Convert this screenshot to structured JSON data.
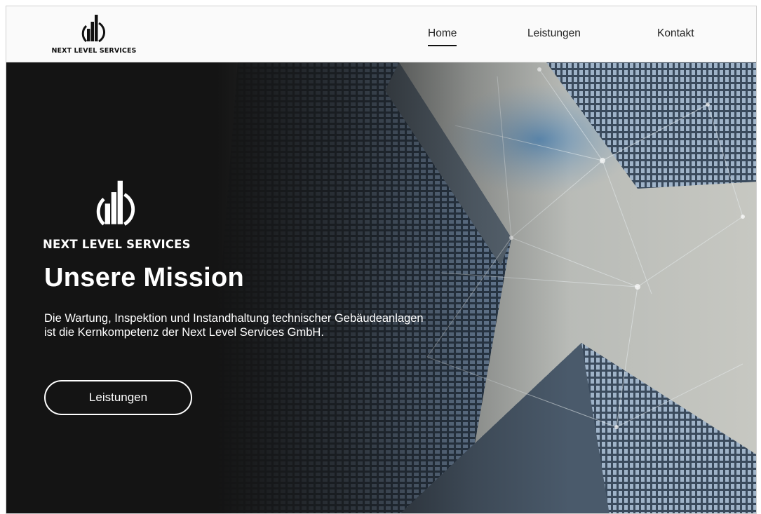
{
  "brand": {
    "name": "NEXT LEVEL SERVICES",
    "logo_icon": "building-bars-logo"
  },
  "nav": {
    "items": [
      {
        "label": "Home",
        "active": true
      },
      {
        "label": "Leistungen",
        "active": false
      },
      {
        "label": "Kontakt",
        "active": false
      }
    ]
  },
  "hero": {
    "title": "Unsere Mission",
    "text": "Die Wartung, Inspektion und Instandhaltung technischer Gebäudeanlagen ist die Kernkompetenz der Next Level Services GmbH.",
    "button_label": "Leistungen",
    "background": "skyscrapers-network-photo"
  },
  "colors": {
    "header_bg": "#fafafa",
    "hero_dark": "#151515",
    "text_light": "#ffffff",
    "text_dark": "#222222"
  }
}
